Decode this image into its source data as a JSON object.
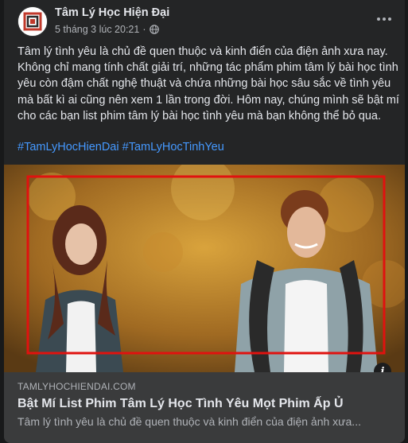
{
  "post": {
    "page_name": "Tâm Lý Học Hiện Đại",
    "timestamp": "5 tháng 3 lúc 20:21",
    "separator": "·",
    "privacy_icon": "globe-icon",
    "body": "Tâm lý tình yêu là chủ đề quen thuộc và kinh điển của điện ảnh xưa nay. Không chỉ mang tính chất giải trí, những tác phẩm phim tâm lý bài học tình yêu còn đậm chất nghệ thuật và chứa những bài học sâu sắc về tình yêu mà bất kì ai cũng nên xem 1 lần trong đời. Hôm nay, chúng mình sẽ bật mí cho các bạn list phim tâm lý bài học tình yêu mà bạn không thể bỏ qua.",
    "hashtags": [
      "#TamLyHocHienDai",
      "#TamLyHocTinhYeu"
    ]
  },
  "link_preview": {
    "domain": "TAMLYHOCHIENDAI.COM",
    "title": "Bật Mí List Phim Tâm Lý Học Tình Yêu Mọt Phim Ấp Ủ",
    "description": "Tâm lý tình yêu là chủ đề quen thuộc và kinh điển của điện ảnh xưa...",
    "info_label": "i"
  },
  "colors": {
    "background": "#18191a",
    "card": "#242526",
    "link_bar": "#3a3b3c",
    "hashtag": "#4599ff",
    "highlight_box": "#e0120f"
  }
}
